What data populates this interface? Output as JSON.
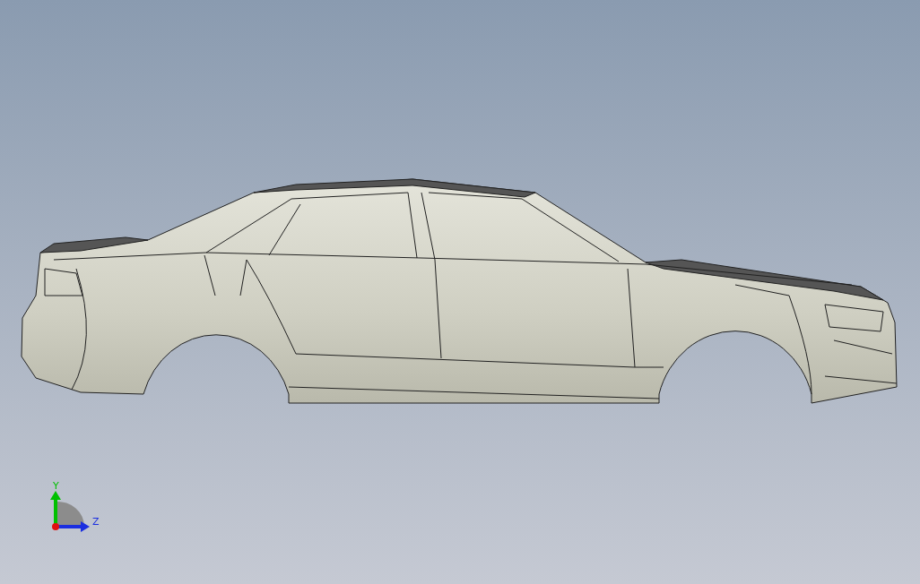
{
  "viewport": {
    "triad": {
      "axes": [
        {
          "label": "Y",
          "kind": "vertical",
          "color": "#00c000"
        },
        {
          "label": "Z",
          "kind": "horizontal",
          "color": "#1a2ee0"
        }
      ]
    }
  }
}
